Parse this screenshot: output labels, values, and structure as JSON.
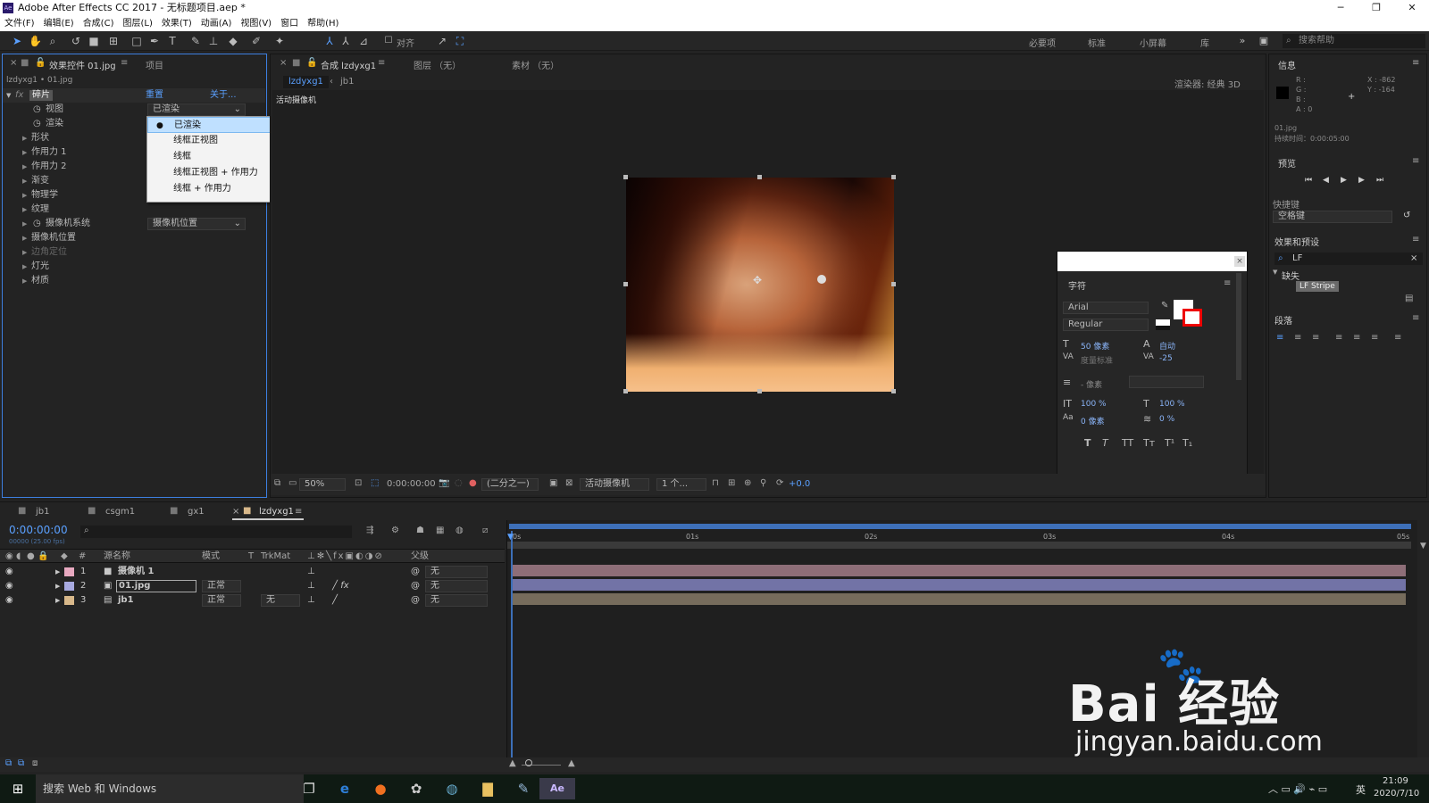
{
  "window": {
    "title": "Adobe After Effects CC 2017 - 无标题项目.aep *",
    "app_badge": "Ae",
    "controls": [
      "─",
      "❐",
      "✕"
    ]
  },
  "menu": [
    "文件(F)",
    "编辑(E)",
    "合成(C)",
    "图层(L)",
    "效果(T)",
    "动画(A)",
    "视图(V)",
    "窗口",
    "帮助(H)"
  ],
  "toolbar": {
    "align_label": "对齐",
    "workspaces": [
      "必要项",
      "标准",
      "小屏幕",
      "库"
    ],
    "search_placeholder": "搜索帮助"
  },
  "effect_panel": {
    "tab_label": "效果控件 01.jpg",
    "tab2": "项目",
    "subtitle": "lzdyxg1 • 01.jpg",
    "fx_name": "碎片",
    "reset": "重置",
    "about": "关于...",
    "view_label": "视图",
    "view_value": "已渲染",
    "render_label": "渲染",
    "props": [
      "形状",
      "作用力 1",
      "作用力 2",
      "渐变",
      "物理学",
      "纹理"
    ],
    "camera_system_label": "摄像机系统",
    "camera_system_value": "摄像机位置",
    "props2": [
      "摄像机位置",
      "边角定位",
      "灯光",
      "材质"
    ],
    "menu_items": [
      "已渲染",
      "线框正视图",
      "线框",
      "线框正视图 + 作用力",
      "线框 + 作用力"
    ]
  },
  "comp_panel": {
    "tab_label": "合成 lzdyxg1",
    "layer_tab": "图层 （无）",
    "footage_tab": "素材 （无）",
    "crumbs": [
      "lzdyxg1",
      "jb1"
    ],
    "renderer": "渲染器: 经典 3D",
    "camera_label": "活动摄像机",
    "footer": {
      "zoom": "50%",
      "time": "0:00:00:00",
      "res": "(二分之一)",
      "view": "活动摄像机",
      "views": "1 个...",
      "exposure": "+0.0"
    }
  },
  "info_panel": {
    "title": "信息",
    "rgb": [
      "R :",
      "G :",
      "B :",
      "A : 0"
    ],
    "xy": [
      "X : -862",
      "Y : -164"
    ],
    "file": "01.jpg",
    "duration": "持续时间：0:00:05:00"
  },
  "preview_panel": {
    "title": "预览",
    "shortcut_label": "快捷键",
    "shortcut_value": "空格键"
  },
  "effects_presets": {
    "title": "效果和预设",
    "search": "LF",
    "group": "缺失",
    "item": "LF Stripe"
  },
  "paragraph_panel": {
    "title": "段落"
  },
  "character_panel": {
    "title": "字符",
    "font": "Arial",
    "style": "Regular",
    "size": "50 像素",
    "leading": "自动",
    "kerning": "度量标准",
    "tracking": "-25",
    "stroke": "- 像素",
    "vscale": "100 %",
    "hscale": "100 %",
    "baseline": "0 像素",
    "tsume": "0 %",
    "styles": [
      "T",
      "T",
      "TT",
      "Tт",
      "T¹",
      "T₁"
    ]
  },
  "timeline": {
    "tabs": [
      "jb1",
      "csgm1",
      "gx1",
      "lzdyxg1"
    ],
    "time": "0:00:00:00",
    "fps": "00000 (25.00 fps)",
    "headers": {
      "num": "#",
      "name": "源名称",
      "mode": "模式",
      "t": "T",
      "trkmat": "TrkMat",
      "parent": "父级"
    },
    "rulers": [
      "0s",
      "01s",
      "02s",
      "03s",
      "04s",
      "05s"
    ],
    "layers": [
      {
        "num": "1",
        "name": "摄像机 1",
        "mode": "",
        "trkmat": "",
        "parent": "无",
        "color": "#e8a9c0",
        "track": "#8e6e78"
      },
      {
        "num": "2",
        "name": "01.jpg",
        "mode": "正常",
        "trkmat": "",
        "parent": "无",
        "color": "#a7a9e0",
        "track": "#7273a6"
      },
      {
        "num": "3",
        "name": "jb1",
        "mode": "正常",
        "trkmat": "无",
        "parent": "无",
        "color": "#d8b88a",
        "track": "#766c5c"
      }
    ]
  },
  "taskbar": {
    "search": "搜索 Web 和 Windows",
    "time": "21:09",
    "date": "2020/7/10",
    "lang": "英"
  },
  "watermark": {
    "logo": "Bai 经验",
    "url": "jingyan.baidu.com"
  }
}
